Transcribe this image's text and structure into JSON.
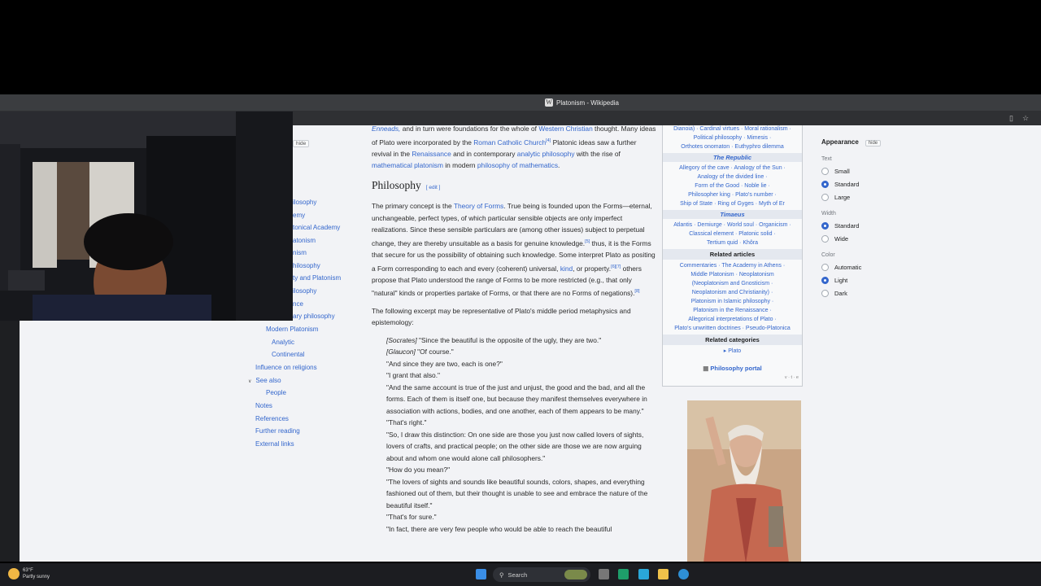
{
  "window": {
    "title": "Platonism - Wikipedia",
    "tab_icon": "W"
  },
  "toc": {
    "hide_label": "hide",
    "items": [
      {
        "label": "ilosophy",
        "indent": 1
      },
      {
        "label": "emy",
        "indent": 1
      },
      {
        "label": "tonical Academy",
        "indent": 1
      },
      {
        "label": "atonism",
        "indent": 1
      },
      {
        "label": "nism",
        "indent": 1
      },
      {
        "label": "hilosophy",
        "indent": 1
      },
      {
        "label": "ty and Platonism",
        "indent": 1
      },
      {
        "label": "ilosophy",
        "indent": 1
      },
      {
        "label": "nce",
        "indent": 1
      },
      {
        "label": "ary philosophy",
        "indent": 1
      },
      {
        "label": "Modern Platonism",
        "indent": 2
      },
      {
        "label": "Analytic",
        "indent": 3
      },
      {
        "label": "Continental",
        "indent": 3
      },
      {
        "label": "Influence on religions",
        "indent": 1
      },
      {
        "label": "See also",
        "indent": 1,
        "toggle": "∨"
      },
      {
        "label": "People",
        "indent": 2
      },
      {
        "label": "Notes",
        "indent": 1
      },
      {
        "label": "References",
        "indent": 1
      },
      {
        "label": "Further reading",
        "indent": 1
      },
      {
        "label": "External links",
        "indent": 1
      }
    ]
  },
  "article": {
    "intro": {
      "p1a": "Enneads,",
      "p1b": " and in turn were foundations for the whole of ",
      "p1c": "Western Christian",
      "p1d": " thought.",
      "p2a": "Many ideas of Plato were incorporated by the ",
      "p2b": "Roman Catholic Church",
      "p2c": "[4]",
      "p2d": " Platonic ideas saw a further revival in the ",
      "p2e": "Renaissance",
      "p2f": " and in contemporary ",
      "p2g": "analytic philosophy",
      "p2h": " with the rise of ",
      "p2i": "mathematical platonism",
      "p2j": " in modern ",
      "p2k": "philosophy of mathematics",
      "p2l": "."
    },
    "heading": "Philosophy",
    "edit_label": "[ edit ]",
    "para1": {
      "a": "The primary concept is the ",
      "b": "Theory of Forms",
      "c": ". True being is founded upon the Forms—eternal, unchangeable, perfect types, of which particular sensible objects are only imperfect realizations. Since these sensible particulars are (among other issues) subject to perpetual change, they are thereby unsuitable as a basis for genuine knowledge.",
      "d": "[5]",
      "e": " thus, it is the Forms that secure for us the possibility of obtaining such knowledge. Some interpret Plato as positing a Form corresponding to each and every (coherent) universal, ",
      "f": "kind",
      "g": ", or property.",
      "h": "[6][7]",
      "i": " others propose that Plato understood the range of Forms to be more restricted (e.g., that only \"natural\" kinds or properties partake of Forms, or that there are no Forms of negations).",
      "j": "[8]"
    },
    "para2": "The following excerpt may be representative of Plato's middle period metaphysics and epistemology:",
    "quote": [
      "[Socrates] \"Since the beautiful is the opposite of the ugly, they are two.\"",
      "[Glaucon] \"Of course.\"",
      "\"And since they are two, each is one?\"",
      "\"I grant that also.\"",
      "\"And the same account is true of the just and unjust, the good and the bad, and all the forms. Each of them is itself one, but because they manifest themselves everywhere in association with actions, bodies, and one another, each of them appears to be many.\"",
      "\"That's right.\"",
      "\"So, I draw this distinction: On one side are those you just now called lovers of sights, lovers of crafts, and practical people; on the other side are those we are now arguing about and whom one would alone call philosophers.\"",
      "\"How do you mean?\"",
      "\"The lovers of sights and sounds like beautiful sounds, colors, shapes, and everything fashioned out of them, but their thought is unable to see and embrace the nature of the beautiful itself.\"",
      "\"That's for sure.\"",
      "\"In fact, there are very few people who would be able to reach the beautiful"
    ]
  },
  "navbox": {
    "top_lines": [
      "Dianoia) · Cardinal virtues · Moral rationalism ·",
      "Political philosophy · Mimesis ·",
      "Orthotes onomaton · Euthyphro dilemma"
    ],
    "republic_title": "The Republic",
    "republic_lines": [
      "Allegory of the cave · Analogy of the Sun ·",
      "Analogy of the divided line ·",
      "Form of the Good · Noble lie ·",
      "Philosopher king · Plato's number ·",
      "Ship of State · Ring of Gyges · Myth of Er"
    ],
    "timaeus_title": "Timaeus",
    "timaeus_lines": [
      "Atlantis · Demiurge · World soul · Organicism ·",
      "Classical element · Platonic solid ·",
      "Tertium quid · Khôra"
    ],
    "related_articles_title": "Related articles",
    "related_articles_lines": [
      "Commentaries · The Academy in Athens ·",
      "Middle Platonism · Neoplatonism",
      "(Neoplatonism and Gnosticism ·",
      "Neoplatonism and Christianity) ·",
      "Platonism in Islamic philosophy ·",
      "Platonism in the Renaissance ·",
      "Allegorical interpretations of Plato ·",
      "Plato's unwritten doctrines · Pseudo-Platonica"
    ],
    "related_categories_title": "Related categories",
    "category_item": "▸ Plato",
    "portal_label": "Philosophy portal",
    "vte": "v · t · e"
  },
  "appearance": {
    "title": "Appearance",
    "hide_label": "hide",
    "text_label": "Text",
    "text_options": [
      {
        "label": "Small",
        "checked": false
      },
      {
        "label": "Standard",
        "checked": true
      },
      {
        "label": "Large",
        "checked": false
      }
    ],
    "width_label": "Width",
    "width_options": [
      {
        "label": "Standard",
        "checked": true
      },
      {
        "label": "Wide",
        "checked": false
      }
    ],
    "color_label": "Color",
    "color_options": [
      {
        "label": "Automatic",
        "checked": false
      },
      {
        "label": "Light",
        "checked": true
      },
      {
        "label": "Dark",
        "checked": false
      }
    ]
  },
  "taskbar": {
    "temp": "63°F",
    "weather": "Partly sunny",
    "search_placeholder": "Search"
  },
  "colors": {
    "link": "#3366cc",
    "page_bg": "#f2f3f6",
    "radio_on": "#3366cc"
  }
}
